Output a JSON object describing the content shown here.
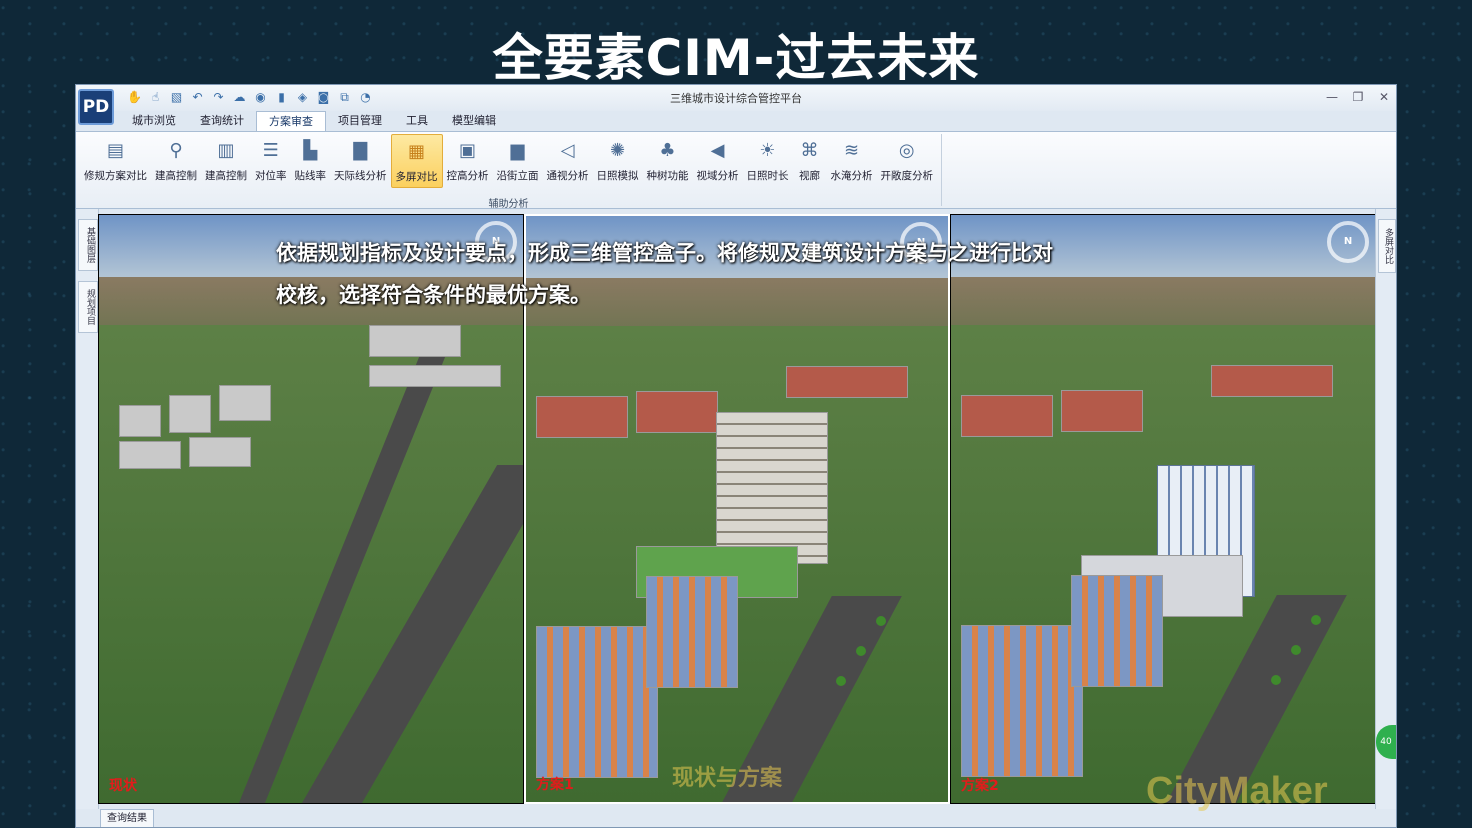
{
  "slide": {
    "title": "全要素CIM-过去未来"
  },
  "window": {
    "logo": "PD",
    "title": "三维城市设计综合管控平台",
    "controls": [
      "—",
      "❐",
      "✕"
    ],
    "quick_access_icons": [
      "hand-icon",
      "pan-icon",
      "select-icon",
      "undo-icon",
      "redo-icon",
      "cloud-icon",
      "globe-icon",
      "doc-icon",
      "layers-icon",
      "camera-icon",
      "export-icon",
      "settings-icon"
    ]
  },
  "tabs": [
    "城市浏览",
    "查询统计",
    "方案审查",
    "项目管理",
    "工具",
    "模型编辑"
  ],
  "active_tab": "方案审查",
  "ribbon": {
    "buttons": [
      {
        "label": "修规方案对比",
        "icon": "compare-icon",
        "glyph": "▤"
      },
      {
        "label": "建高控制",
        "icon": "height-pin-icon",
        "glyph": "⚲"
      },
      {
        "label": "建高控制",
        "icon": "building-height-icon",
        "glyph": "▥"
      },
      {
        "label": "对位率",
        "icon": "align-icon",
        "glyph": "☰"
      },
      {
        "label": "贴线率",
        "icon": "line-rate-icon",
        "glyph": "▙"
      },
      {
        "label": "天际线分析",
        "icon": "skyline-icon",
        "glyph": "▇"
      },
      {
        "label": "多屏对比",
        "icon": "multi-screen-icon",
        "glyph": "▦"
      },
      {
        "label": "控高分析",
        "icon": "height-analysis-icon",
        "glyph": "▣"
      },
      {
        "label": "沿街立面",
        "icon": "street-facade-icon",
        "glyph": "▆"
      },
      {
        "label": "通视分析",
        "icon": "sightline-icon",
        "glyph": "◁"
      },
      {
        "label": "日照模拟",
        "icon": "sunlight-sim-icon",
        "glyph": "✺"
      },
      {
        "label": "种树功能",
        "icon": "tree-icon",
        "glyph": "♣"
      },
      {
        "label": "视域分析",
        "icon": "viewshed-icon",
        "glyph": "◀"
      },
      {
        "label": "日照时长",
        "icon": "sun-duration-icon",
        "glyph": "☀"
      },
      {
        "label": "视廊",
        "icon": "view-corridor-icon",
        "glyph": "⌘"
      },
      {
        "label": "水淹分析",
        "icon": "flood-icon",
        "glyph": "≋"
      },
      {
        "label": "开敞度分析",
        "icon": "openness-icon",
        "glyph": "◎"
      }
    ],
    "active_button": "多屏对比",
    "group_label": "辅助分析"
  },
  "left_rail": [
    "基础图层",
    "规划项目"
  ],
  "right_rail": [
    "多屏对比"
  ],
  "viewports": [
    {
      "label": "现状",
      "compass": "N"
    },
    {
      "label": "方案1",
      "compass": "N"
    },
    {
      "label": "方案2",
      "compass": "N"
    }
  ],
  "overlay_text": "依据规划指标及设计要点，形成三维管控盒子。将修规及建筑设计方案与之进行比对校核，选择符合条件的最优方案。",
  "watermarks": [
    "现状与方案",
    "CityMaker"
  ],
  "status_tab": "查询结果",
  "side_badge": "40"
}
